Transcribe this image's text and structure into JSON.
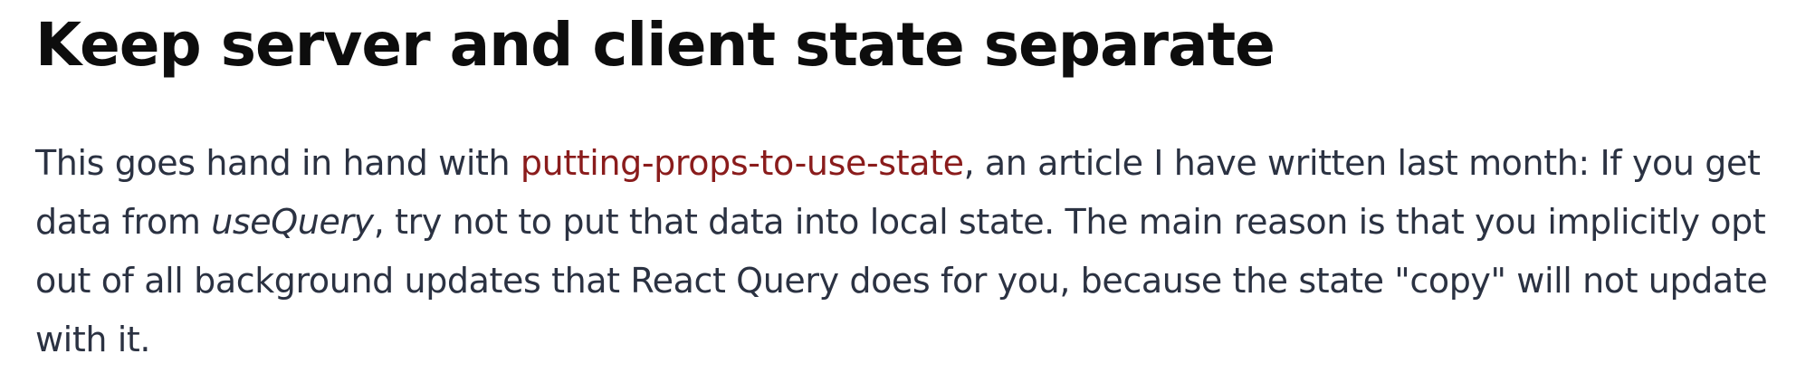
{
  "heading": "Keep server and client state separate",
  "paragraph": {
    "before_link": "This goes hand in hand with ",
    "link_text": "putting-props-to-use-state",
    "after_link": ", an article I have written last month: If you get data from ",
    "emphasis": "useQuery",
    "after_emphasis": ", try not to put that data into local state. The main reason is that you implicitly opt out of all background updates that React Query does for you, because the state \"copy\" will not update with it."
  },
  "colors": {
    "heading": "#0d0d0d",
    "body_text": "#2b3242",
    "link": "#8a1c1c",
    "background": "#ffffff"
  }
}
